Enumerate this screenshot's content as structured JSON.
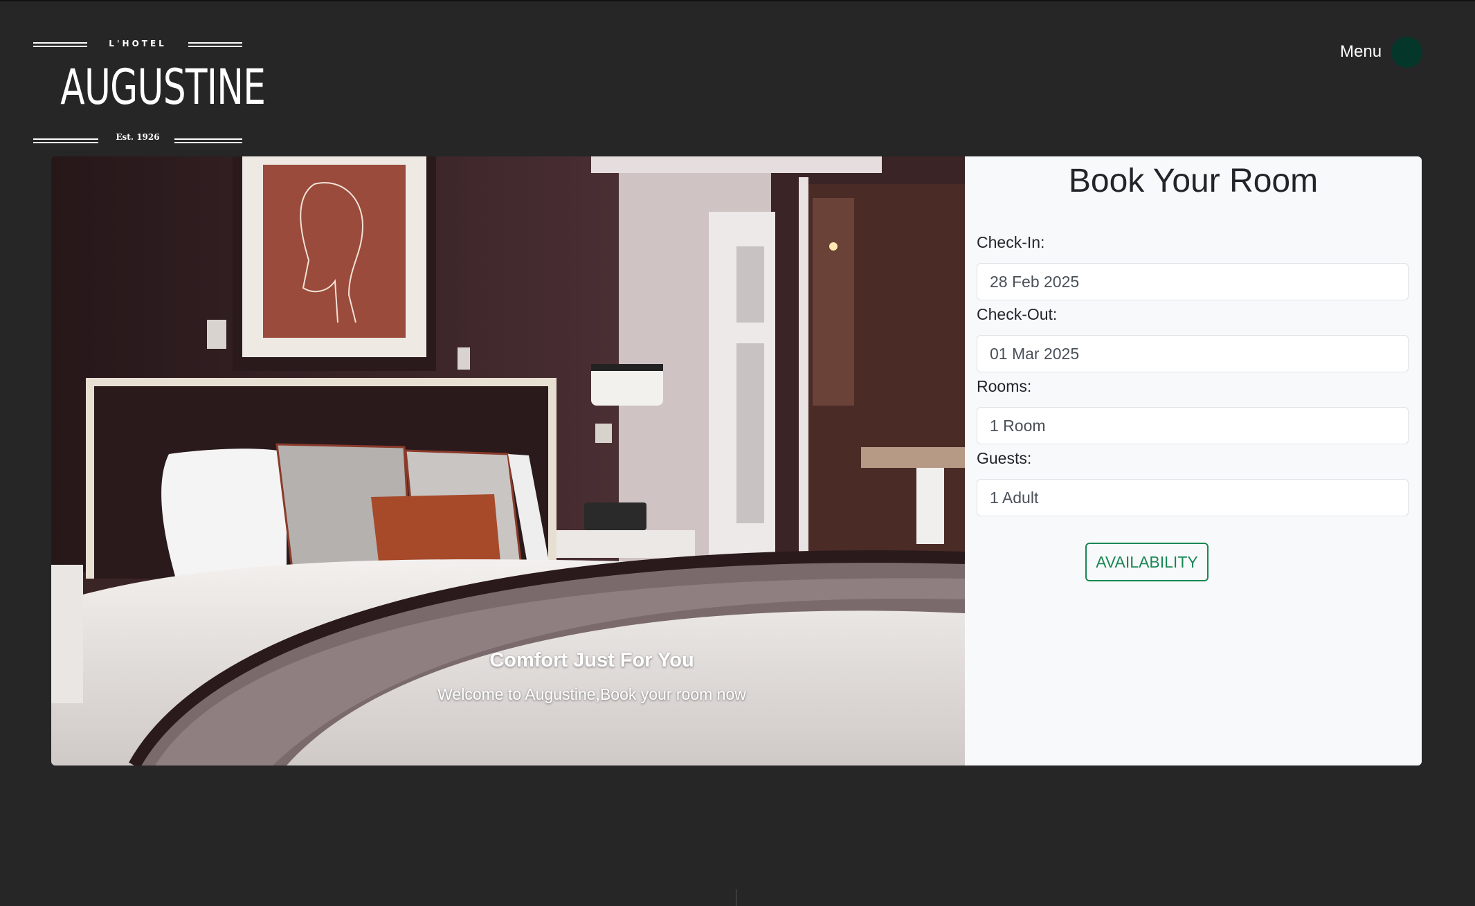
{
  "logo": {
    "top_text": "L'HOTEL",
    "name": "AUGUSTINE",
    "est": "Est. 1926"
  },
  "menu": {
    "label": "Menu"
  },
  "hero": {
    "image_alt": "Hotel room with a bed",
    "caption_title": "Comfort Just For You",
    "caption_subtitle": "Welcome to Augustine,Book your room now"
  },
  "booking": {
    "title": "Book Your Room",
    "check_in": {
      "label": "Check-In:",
      "value": "28 Feb 2025"
    },
    "check_out": {
      "label": "Check-Out:",
      "value": "01 Mar 2025"
    },
    "rooms": {
      "label": "Rooms:",
      "value": "1 Room"
    },
    "guests": {
      "label": "Guests:",
      "value": "1 Adult"
    },
    "button_label": "AVAILABILITY"
  },
  "colors": {
    "background": "#262626",
    "menu_dot": "#04372a",
    "accent": "#198754",
    "panel": "#f8f9fa"
  },
  "icons": {
    "menu": "menu-dot-icon"
  }
}
